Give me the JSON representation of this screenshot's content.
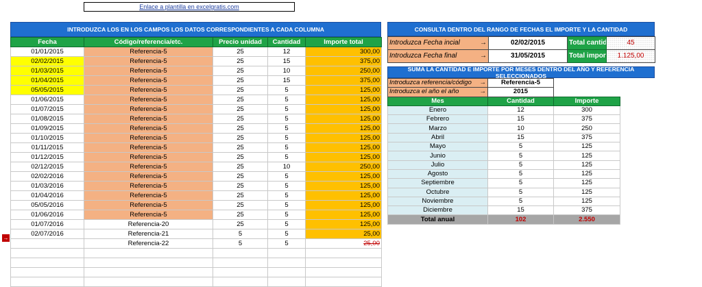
{
  "link_text": "Enlace a plantilla en excelgratis.com",
  "left_banner": "INTRODUZCA LOS EN LOS CAMPOS LOS DATOS CORRESPONDIENTES  A CADA COLUMNA",
  "left_headers": [
    "Fecha",
    "Código/referencia/etc.",
    "Precio unidad",
    "Cantidad",
    "Importe total"
  ],
  "rows": [
    {
      "fecha": "01/01/2015",
      "ref": "Referencia-5",
      "precio": "25",
      "cant": "12",
      "imp": "300,00",
      "hl": false,
      "sal": true,
      "strike": false
    },
    {
      "fecha": "02/02/2015",
      "ref": "Referencia-5",
      "precio": "25",
      "cant": "15",
      "imp": "375,00",
      "hl": true,
      "sal": true,
      "strike": false
    },
    {
      "fecha": "01/03/2015",
      "ref": "Referencia-5",
      "precio": "25",
      "cant": "10",
      "imp": "250,00",
      "hl": true,
      "sal": true,
      "strike": false
    },
    {
      "fecha": "01/04/2015",
      "ref": "Referencia-5",
      "precio": "25",
      "cant": "15",
      "imp": "375,00",
      "hl": true,
      "sal": true,
      "strike": false
    },
    {
      "fecha": "05/05/2015",
      "ref": "Referencia-5",
      "precio": "25",
      "cant": "5",
      "imp": "125,00",
      "hl": true,
      "sal": true,
      "strike": false
    },
    {
      "fecha": "01/06/2015",
      "ref": "Referencia-5",
      "precio": "25",
      "cant": "5",
      "imp": "125,00",
      "hl": false,
      "sal": true,
      "strike": false
    },
    {
      "fecha": "01/07/2015",
      "ref": "Referencia-5",
      "precio": "25",
      "cant": "5",
      "imp": "125,00",
      "hl": false,
      "sal": true,
      "strike": false
    },
    {
      "fecha": "01/08/2015",
      "ref": "Referencia-5",
      "precio": "25",
      "cant": "5",
      "imp": "125,00",
      "hl": false,
      "sal": true,
      "strike": false
    },
    {
      "fecha": "01/09/2015",
      "ref": "Referencia-5",
      "precio": "25",
      "cant": "5",
      "imp": "125,00",
      "hl": false,
      "sal": true,
      "strike": false
    },
    {
      "fecha": "01/10/2015",
      "ref": "Referencia-5",
      "precio": "25",
      "cant": "5",
      "imp": "125,00",
      "hl": false,
      "sal": true,
      "strike": false
    },
    {
      "fecha": "01/11/2015",
      "ref": "Referencia-5",
      "precio": "25",
      "cant": "5",
      "imp": "125,00",
      "hl": false,
      "sal": true,
      "strike": false
    },
    {
      "fecha": "01/12/2015",
      "ref": "Referencia-5",
      "precio": "25",
      "cant": "5",
      "imp": "125,00",
      "hl": false,
      "sal": true,
      "strike": false
    },
    {
      "fecha": "02/12/2015",
      "ref": "Referencia-5",
      "precio": "25",
      "cant": "10",
      "imp": "250,00",
      "hl": false,
      "sal": true,
      "strike": false
    },
    {
      "fecha": "02/02/2016",
      "ref": "Referencia-5",
      "precio": "25",
      "cant": "5",
      "imp": "125,00",
      "hl": false,
      "sal": true,
      "strike": false
    },
    {
      "fecha": "01/03/2016",
      "ref": "Referencia-5",
      "precio": "25",
      "cant": "5",
      "imp": "125,00",
      "hl": false,
      "sal": true,
      "strike": false
    },
    {
      "fecha": "01/04/2016",
      "ref": "Referencia-5",
      "precio": "25",
      "cant": "5",
      "imp": "125,00",
      "hl": false,
      "sal": true,
      "strike": false
    },
    {
      "fecha": "05/05/2016",
      "ref": "Referencia-5",
      "precio": "25",
      "cant": "5",
      "imp": "125,00",
      "hl": false,
      "sal": true,
      "strike": false
    },
    {
      "fecha": "01/06/2016",
      "ref": "Referencia-5",
      "precio": "25",
      "cant": "5",
      "imp": "125,00",
      "hl": false,
      "sal": true,
      "strike": false
    },
    {
      "fecha": "01/07/2016",
      "ref": "Referencia-20",
      "precio": "25",
      "cant": "5",
      "imp": "125,00",
      "hl": false,
      "sal": false,
      "strike": false
    },
    {
      "fecha": "02/07/2016",
      "ref": "Referencia-21",
      "precio": "5",
      "cant": "5",
      "imp": "25,00",
      "hl": false,
      "sal": false,
      "strike": false
    },
    {
      "fecha": "",
      "ref": "Referencia-22",
      "precio": "5",
      "cant": "5",
      "imp": "25,00",
      "hl": false,
      "sal": false,
      "strike": true
    }
  ],
  "row_marker_icon": "→",
  "query": {
    "banner": "CONSULTA DENTRO DEL RANGO DE FECHAS EL IMPORTE Y LA CANTIDAD",
    "label_start": "Introduzca Fecha incial",
    "label_end": "Introduzca Fecha final",
    "arrow": "→",
    "start_date": "02/02/2015",
    "end_date": "31/05/2015",
    "total_cantidad_label": "Total cantidad",
    "total_importe_label": "Total importe",
    "total_cantidad": "45",
    "total_importe": "1.125,00"
  },
  "monthly": {
    "banner": "SUMA LA CANTIDAD E IMPORTE POR MESES DENTRO DEL AÑO Y REFERENCIA SELECCIONADOS",
    "label_ref": "Introduzca referencia/código",
    "label_year": "Introduzca el año el año",
    "arrow": "→",
    "ref_value": "Referencia-5",
    "year_value": "2015",
    "headers": [
      "Mes",
      "Cantidad",
      "Importe"
    ],
    "months": [
      {
        "mes": "Enero",
        "cant": "12",
        "imp": "300"
      },
      {
        "mes": "Febrero",
        "cant": "15",
        "imp": "375"
      },
      {
        "mes": "Marzo",
        "cant": "10",
        "imp": "250"
      },
      {
        "mes": "Abril",
        "cant": "15",
        "imp": "375"
      },
      {
        "mes": "Mayo",
        "cant": "5",
        "imp": "125"
      },
      {
        "mes": "Junio",
        "cant": "5",
        "imp": "125"
      },
      {
        "mes": "Julio",
        "cant": "5",
        "imp": "125"
      },
      {
        "mes": "Agosto",
        "cant": "5",
        "imp": "125"
      },
      {
        "mes": "Septiembre",
        "cant": "5",
        "imp": "125"
      },
      {
        "mes": "Octubre",
        "cant": "5",
        "imp": "125"
      },
      {
        "mes": "Noviembre",
        "cant": "5",
        "imp": "125"
      },
      {
        "mes": "Diciembre",
        "cant": "15",
        "imp": "375"
      }
    ],
    "total_label": "Total anual",
    "total_cant": "102",
    "total_imp": "2.550"
  }
}
